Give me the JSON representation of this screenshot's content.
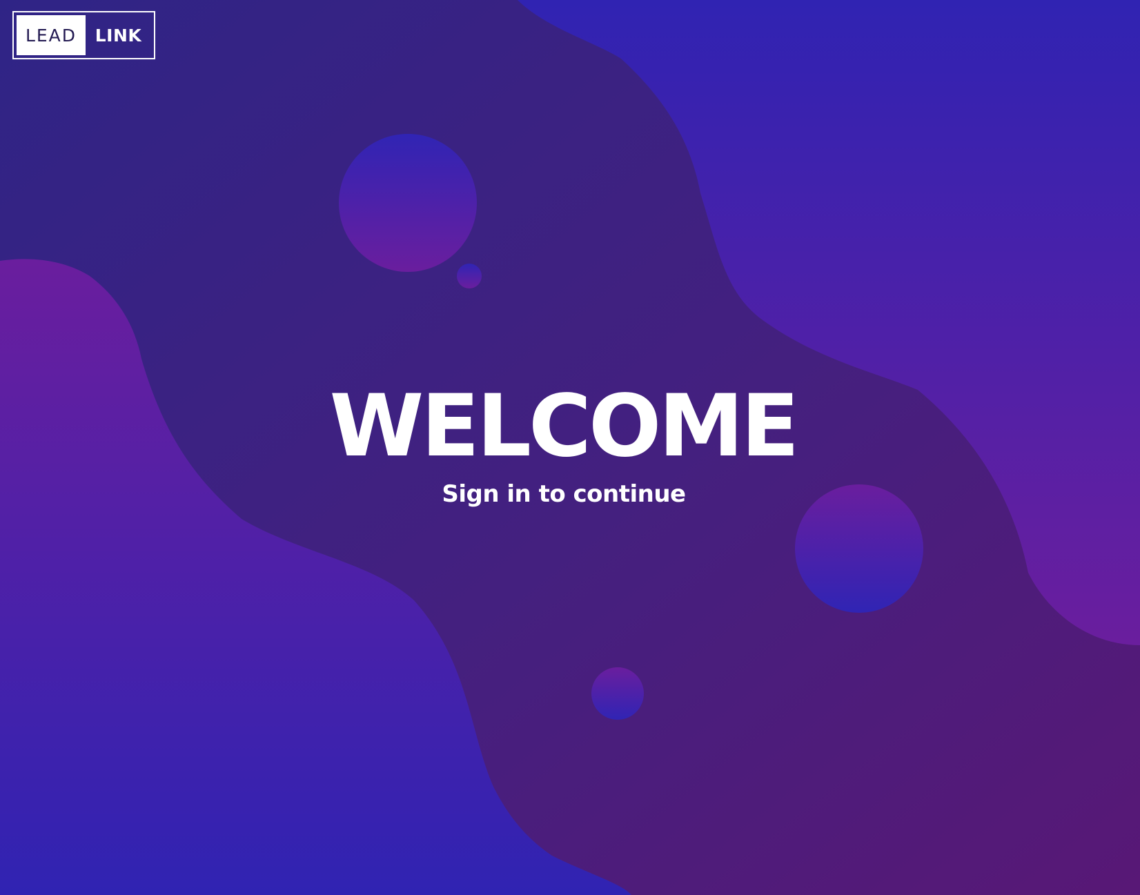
{
  "logo": {
    "left_text": "LEAD",
    "right_text": "LINK"
  },
  "hero": {
    "title": "WELCOME",
    "subtitle": "Sign in to continue"
  },
  "colors": {
    "background_dark": "#35237f",
    "blob_blue": "#3223b0",
    "blob_magenta": "#6a1ea0",
    "text": "#ffffff"
  }
}
